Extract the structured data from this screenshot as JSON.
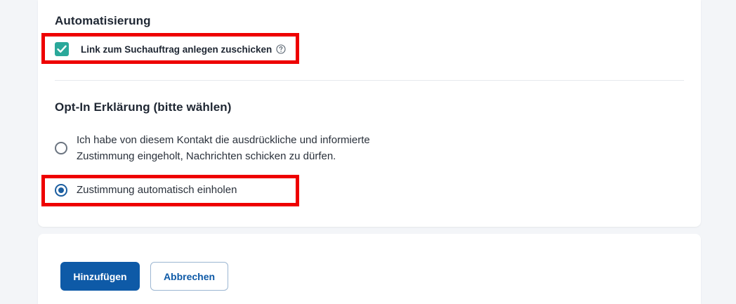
{
  "automation": {
    "title": "Automatisierung",
    "checkbox_label": "Link zum Suchauftrag anlegen zuschicken",
    "checkbox_checked": true
  },
  "optin": {
    "title": "Opt-In Erklärung (bitte wählen)",
    "options": [
      {
        "line1": "Ich habe von diesem Kontakt die ausdrückliche und informierte",
        "line2": "Zustimmung eingeholt, Nachrichten schicken zu dürfen.",
        "selected": false
      },
      {
        "line1": "Zustimmung automatisch einholen",
        "selected": true
      }
    ]
  },
  "actions": {
    "add_label": "Hinzufügen",
    "cancel_label": "Abbrechen"
  },
  "colors": {
    "accent": "#0e5aa7",
    "checkbox": "#2aa89a",
    "highlight": "#ee0000"
  }
}
